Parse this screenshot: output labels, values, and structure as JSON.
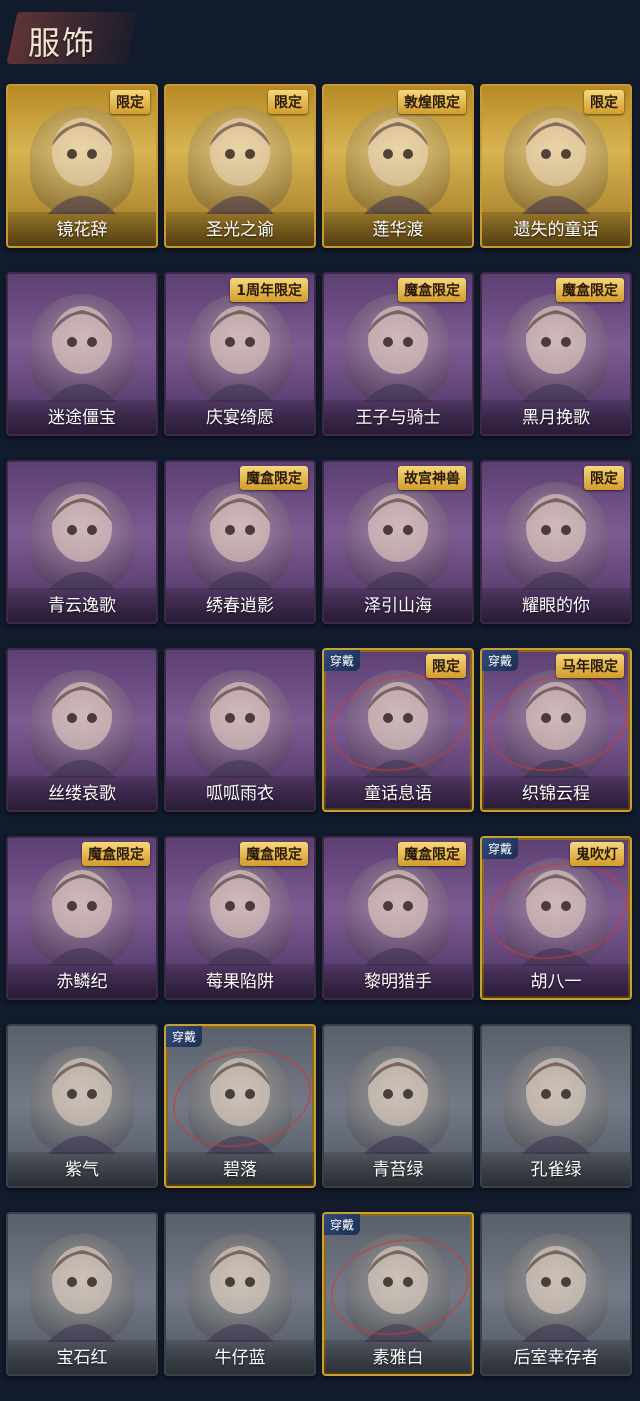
{
  "header": {
    "title": "服饰"
  },
  "colors": {
    "background": "#121b2b",
    "badge": "#d39c2c",
    "equipped_ring": "#c83c3c"
  },
  "rows": [
    {
      "items": [
        {
          "name": "镜花辞",
          "badge": "限定",
          "equipped": false,
          "tier": "gold",
          "icon": "character-portrait"
        },
        {
          "name": "圣光之谕",
          "badge": "限定",
          "equipped": false,
          "tier": "gold",
          "icon": "character-portrait"
        },
        {
          "name": "莲华渡",
          "badge": "敦煌限定",
          "equipped": false,
          "tier": "gold",
          "icon": "character-portrait"
        },
        {
          "name": "遗失的童话",
          "badge": "限定",
          "equipped": false,
          "tier": "gold",
          "icon": "character-portrait"
        }
      ]
    },
    {
      "items": [
        {
          "name": "迷途僵宝",
          "badge": "",
          "equipped": false,
          "tier": "purple",
          "icon": "character-portrait"
        },
        {
          "name": "庆宴绮愿",
          "badge": "1周年限定",
          "equipped": false,
          "tier": "purple",
          "icon": "character-portrait"
        },
        {
          "name": "王子与骑士",
          "badge": "魔盒限定",
          "equipped": false,
          "tier": "purple",
          "icon": "character-portrait"
        },
        {
          "name": "黑月挽歌",
          "badge": "魔盒限定",
          "equipped": false,
          "tier": "purple",
          "icon": "character-portrait"
        }
      ]
    },
    {
      "items": [
        {
          "name": "青云逸歌",
          "badge": "",
          "equipped": false,
          "tier": "purple",
          "icon": "character-portrait"
        },
        {
          "name": "绣春逍影",
          "badge": "魔盒限定",
          "equipped": false,
          "tier": "purple",
          "icon": "character-portrait"
        },
        {
          "name": "泽引山海",
          "badge": "故宫神兽",
          "equipped": false,
          "tier": "purple",
          "icon": "character-portrait"
        },
        {
          "name": "耀眼的你",
          "badge": "限定",
          "equipped": false,
          "tier": "purple",
          "icon": "character-portrait"
        }
      ]
    },
    {
      "items": [
        {
          "name": "丝缕哀歌",
          "badge": "",
          "equipped": false,
          "tier": "purple",
          "icon": "character-portrait"
        },
        {
          "name": "呱呱雨衣",
          "badge": "",
          "equipped": false,
          "tier": "purple",
          "icon": "character-portrait"
        },
        {
          "name": "童话息语",
          "badge": "限定",
          "equipped": true,
          "equip_label": "穿戴",
          "tier": "purple",
          "icon": "character-portrait"
        },
        {
          "name": "织锦云程",
          "badge": "马年限定",
          "equipped": true,
          "equip_label": "穿戴",
          "tier": "purple",
          "icon": "character-portrait"
        }
      ]
    },
    {
      "items": [
        {
          "name": "赤鳞纪",
          "badge": "魔盒限定",
          "equipped": false,
          "tier": "purple",
          "icon": "character-portrait"
        },
        {
          "name": "莓果陷阱",
          "badge": "魔盒限定",
          "equipped": false,
          "tier": "purple",
          "icon": "character-portrait"
        },
        {
          "name": "黎明猎手",
          "badge": "魔盒限定",
          "equipped": false,
          "tier": "purple",
          "icon": "character-portrait"
        },
        {
          "name": "胡八一",
          "badge": "鬼吹灯",
          "equipped": true,
          "equip_label": "穿戴",
          "tier": "purple",
          "icon": "character-portrait"
        }
      ]
    },
    {
      "items": [
        {
          "name": "紫气",
          "badge": "",
          "equipped": false,
          "tier": "gray",
          "icon": "character-portrait"
        },
        {
          "name": "碧落",
          "badge": "",
          "equipped": true,
          "equip_label": "穿戴",
          "tier": "gray",
          "icon": "character-portrait"
        },
        {
          "name": "青苔绿",
          "badge": "",
          "equipped": false,
          "tier": "gray",
          "icon": "character-portrait"
        },
        {
          "name": "孔雀绿",
          "badge": "",
          "equipped": false,
          "tier": "gray",
          "icon": "character-portrait"
        }
      ]
    },
    {
      "items": [
        {
          "name": "宝石红",
          "badge": "",
          "equipped": false,
          "tier": "gray",
          "icon": "character-portrait"
        },
        {
          "name": "牛仔蓝",
          "badge": "",
          "equipped": false,
          "tier": "gray",
          "icon": "character-portrait"
        },
        {
          "name": "素雅白",
          "badge": "",
          "equipped": true,
          "equip_label": "穿戴",
          "tier": "gray",
          "icon": "character-portrait"
        },
        {
          "name": "后室幸存者",
          "badge": "",
          "equipped": false,
          "tier": "gray",
          "icon": "hazmat-portrait"
        }
      ]
    }
  ]
}
